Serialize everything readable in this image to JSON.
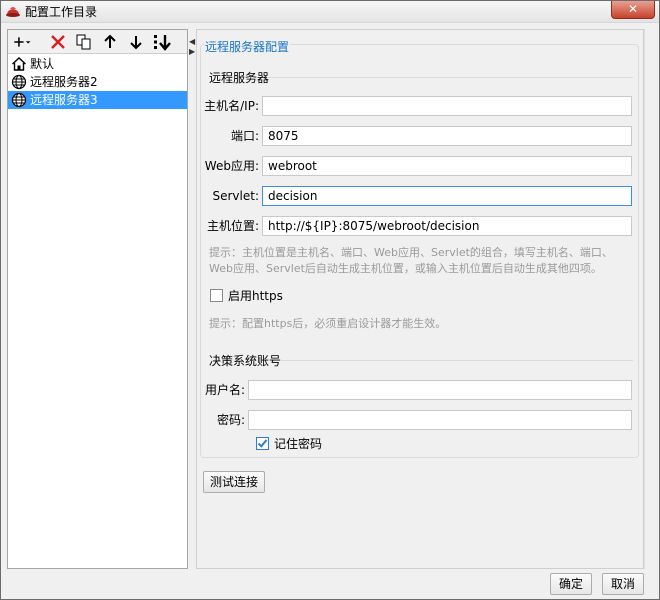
{
  "window": {
    "title": "配置工作目录",
    "close_glyph": "✕"
  },
  "toolbar": {
    "icons": [
      "add-icon",
      "delete-icon",
      "copy-icon",
      "move-up-icon",
      "move-down-icon",
      "sort-icon"
    ]
  },
  "tree": {
    "items": [
      {
        "label": "默认",
        "icon": "home-icon"
      },
      {
        "label": "远程服务器2",
        "icon": "globe-icon"
      },
      {
        "label": "远程服务器3",
        "icon": "globe-icon",
        "selected": true
      }
    ]
  },
  "panel": {
    "title": "远程服务器配置",
    "server_section": "远程服务器",
    "fields": {
      "host_label": "主机名/IP:",
      "host_value": "",
      "port_label": "端口:",
      "port_value": "8075",
      "webapp_label": "Web应用:",
      "webapp_value": "webroot",
      "servlet_label": "Servlet:",
      "servlet_value": "decision",
      "location_label": "主机位置:",
      "location_value": "http://${IP}:8075/webroot/decision"
    },
    "hint1_line1": "提示：主机位置是主机名、端口、Web应用、Servlet的组合，填写主机名、端口、",
    "hint1_line2": "Web应用、Servlet后自动生成主机位置，或输入主机位置后自动生成其他四项。",
    "https_label": "启用https",
    "https_checked": false,
    "hint2": "提示：配置https后，必须重启设计器才能生效。",
    "account_section": "决策系统账号",
    "username_label": "用户名:",
    "username_value": "",
    "password_label": "密码:",
    "password_value": "",
    "remember_label": "记住密码",
    "remember_checked": true,
    "test_button": "测试连接"
  },
  "footer": {
    "ok": "确定",
    "cancel": "取消"
  },
  "colors": {
    "accent": "#1874c8",
    "selection": "#3399ff",
    "delete_red": "#d42020"
  }
}
